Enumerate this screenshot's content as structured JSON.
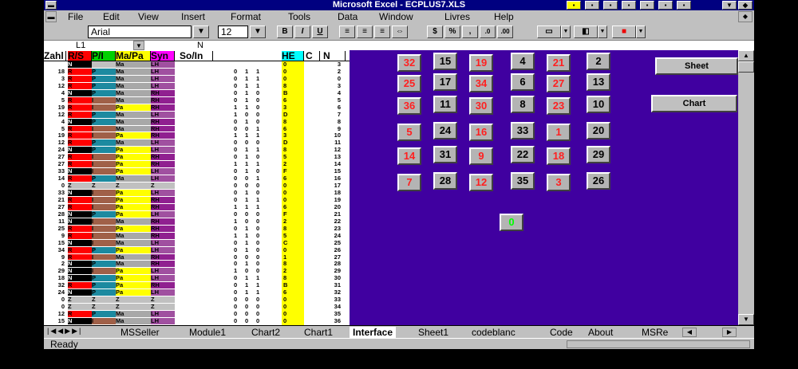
{
  "window": {
    "title": "Microsoft Excel - ECPLUS7.XLS"
  },
  "menu": [
    "File",
    "Edit",
    "View",
    "Insert",
    "Format",
    "Tools",
    "Data",
    "Window",
    "Livres",
    "Help"
  ],
  "toolbar": {
    "font": "Arial",
    "size": "12",
    "bold": "B",
    "italic": "I",
    "underline": "U",
    "percent": "%"
  },
  "formula": {
    "cellref": "L1",
    "content": "N"
  },
  "headers": [
    "Zahl",
    "R/S",
    "P/I",
    "Ma/Pa",
    "Syn",
    "So/In",
    "HE",
    "C",
    "N"
  ],
  "rows": [
    [
      "",
      "N",
      "",
      "Ma",
      "LH",
      "",
      "",
      "",
      "0",
      "3"
    ],
    [
      "18",
      "R",
      "P",
      "Ma",
      "LH",
      "0",
      "1",
      "1",
      "0",
      "2"
    ],
    [
      "3",
      "R",
      "P",
      "Ma",
      "LH",
      "0",
      "1",
      "1",
      "0",
      "0"
    ],
    [
      "12",
      "R",
      "P",
      "Ma",
      "LH",
      "0",
      "1",
      "1",
      "8",
      "3"
    ],
    [
      "4",
      "N",
      "P",
      "Ma",
      "RH",
      "0",
      "1",
      "0",
      "B",
      "4"
    ],
    [
      "5",
      "R",
      "I",
      "Ma",
      "RH",
      "0",
      "1",
      "0",
      "6",
      "5"
    ],
    [
      "19",
      "R",
      "I",
      "Pa",
      "RH",
      "1",
      "1",
      "0",
      "3",
      "6"
    ],
    [
      "12",
      "R",
      "P",
      "Ma",
      "LH",
      "1",
      "0",
      "0",
      "D",
      "7"
    ],
    [
      "4",
      "N",
      "P",
      "Ma",
      "RH",
      "0",
      "1",
      "0",
      "8",
      "8"
    ],
    [
      "5",
      "R",
      "I",
      "Ma",
      "RH",
      "0",
      "0",
      "1",
      "6",
      "9"
    ],
    [
      "19",
      "R",
      "I",
      "Pa",
      "RH",
      "1",
      "1",
      "1",
      "3",
      "10"
    ],
    [
      "12",
      "R",
      "P",
      "Ma",
      "LH",
      "0",
      "0",
      "0",
      "D",
      "11"
    ],
    [
      "24",
      "N",
      "P",
      "Pa",
      "LH",
      "0",
      "1",
      "1",
      "8",
      "12"
    ],
    [
      "27",
      "R",
      "I",
      "Pa",
      "RH",
      "0",
      "1",
      "0",
      "5",
      "13"
    ],
    [
      "27",
      "R",
      "I",
      "Pa",
      "RH",
      "1",
      "1",
      "1",
      "2",
      "14"
    ],
    [
      "33",
      "N",
      "I",
      "Pa",
      "LH",
      "0",
      "1",
      "0",
      "F",
      "15"
    ],
    [
      "14",
      "R",
      "P",
      "Ma",
      "LH",
      "0",
      "0",
      "1",
      "6",
      "16"
    ],
    [
      "0",
      "Z",
      "Z",
      "Z",
      "Z",
      "0",
      "0",
      "0",
      "0",
      "17"
    ],
    [
      "33",
      "N",
      "I",
      "Pa",
      "LH",
      "0",
      "1",
      "0",
      "0",
      "18"
    ],
    [
      "21",
      "R",
      "I",
      "Pa",
      "RH",
      "0",
      "1",
      "1",
      "0",
      "19"
    ],
    [
      "27",
      "R",
      "I",
      "Pa",
      "RH",
      "1",
      "1",
      "1",
      "6",
      "20"
    ],
    [
      "28",
      "N",
      "P",
      "Pa",
      "LH",
      "0",
      "0",
      "0",
      "F",
      "21"
    ],
    [
      "11",
      "N",
      "I",
      "Ma",
      "RH",
      "1",
      "0",
      "0",
      "2",
      "22"
    ],
    [
      "25",
      "R",
      "I",
      "Pa",
      "RH",
      "0",
      "1",
      "0",
      "8",
      "23"
    ],
    [
      "9",
      "R",
      "I",
      "Ma",
      "RH",
      "1",
      "1",
      "0",
      "5",
      "24"
    ],
    [
      "15",
      "N",
      "I",
      "Ma",
      "LH",
      "0",
      "1",
      "0",
      "C",
      "25"
    ],
    [
      "34",
      "R",
      "P",
      "Pa",
      "LH",
      "0",
      "1",
      "0",
      "0",
      "26"
    ],
    [
      "9",
      "R",
      "I",
      "Ma",
      "RH",
      "0",
      "0",
      "0",
      "1",
      "27"
    ],
    [
      "2",
      "N",
      "P",
      "Ma",
      "RH",
      "0",
      "1",
      "0",
      "8",
      "28"
    ],
    [
      "29",
      "N",
      "I",
      "Pa",
      "LH",
      "1",
      "0",
      "0",
      "2",
      "29"
    ],
    [
      "18",
      "N",
      "P",
      "Pa",
      "LH",
      "0",
      "1",
      "1",
      "8",
      "30"
    ],
    [
      "32",
      "R",
      "P",
      "Pa",
      "RH",
      "0",
      "1",
      "1",
      "B",
      "31"
    ],
    [
      "24",
      "N",
      "P",
      "Pa",
      "LH",
      "0",
      "1",
      "1",
      "6",
      "32"
    ],
    [
      "0",
      "Z",
      "Z",
      "Z",
      "Z",
      "0",
      "0",
      "0",
      "0",
      "33"
    ],
    [
      "0",
      "Z",
      "Z",
      "Z",
      "Z",
      "0",
      "0",
      "0",
      "0",
      "34"
    ],
    [
      "12",
      "R",
      "P",
      "Ma",
      "LH",
      "0",
      "0",
      "0",
      "0",
      "35"
    ],
    [
      "15",
      "N",
      "I",
      "Ma",
      "LH",
      "0",
      "0",
      "0",
      "0",
      "36"
    ]
  ],
  "grid_buttons": [
    {
      "label": "32",
      "color": "red"
    },
    {
      "label": "15",
      "color": "black"
    },
    {
      "label": "19",
      "color": "red"
    },
    {
      "label": "4",
      "color": "black"
    },
    {
      "label": "21",
      "color": "red"
    },
    {
      "label": "2",
      "color": "black"
    },
    {
      "label": "25",
      "color": "red"
    },
    {
      "label": "17",
      "color": "black"
    },
    {
      "label": "34",
      "color": "red"
    },
    {
      "label": "6",
      "color": "black"
    },
    {
      "label": "27",
      "color": "red"
    },
    {
      "label": "13",
      "color": "black"
    },
    {
      "label": "36",
      "color": "red"
    },
    {
      "label": "11",
      "color": "black"
    },
    {
      "label": "30",
      "color": "red"
    },
    {
      "label": "8",
      "color": "black"
    },
    {
      "label": "23",
      "color": "red"
    },
    {
      "label": "10",
      "color": "black"
    },
    {
      "label": "5",
      "color": "red"
    },
    {
      "label": "24",
      "color": "black"
    },
    {
      "label": "16",
      "color": "red"
    },
    {
      "label": "33",
      "color": "black"
    },
    {
      "label": "1",
      "color": "red"
    },
    {
      "label": "20",
      "color": "black"
    },
    {
      "label": "14",
      "color": "red"
    },
    {
      "label": "31",
      "color": "black"
    },
    {
      "label": "9",
      "color": "red"
    },
    {
      "label": "22",
      "color": "black"
    },
    {
      "label": "18",
      "color": "red"
    },
    {
      "label": "29",
      "color": "black"
    },
    {
      "label": "7",
      "color": "red"
    },
    {
      "label": "28",
      "color": "black"
    },
    {
      "label": "12",
      "color": "red"
    },
    {
      "label": "35",
      "color": "black"
    },
    {
      "label": "3",
      "color": "red"
    },
    {
      "label": "26",
      "color": "black"
    }
  ],
  "zero_button": {
    "label": "0",
    "color": "green"
  },
  "side_buttons": {
    "sheet": "Sheet",
    "chart": "Chart"
  },
  "tabs": [
    "MSSeller",
    "Module1",
    "Chart2",
    "Chart1",
    "Interface",
    "Sheet1",
    "codeblanc",
    "Code",
    "About",
    "MSRe"
  ],
  "active_tab": "Interface",
  "status": "Ready",
  "colors": {
    "R": "#ff0000",
    "N": "#000000",
    "Z": "#c0c0c0",
    "P": "#1c8aa0",
    "I": "#a06048",
    "Ma": "#a8a8a8",
    "Pa": "#ffff00",
    "LH": "#a050a0",
    "RH": "#902090",
    "purple": "#4000a0"
  }
}
